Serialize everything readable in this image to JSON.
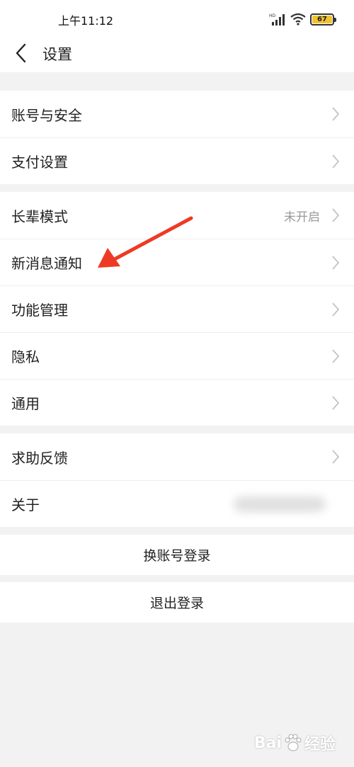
{
  "status_bar": {
    "time": "上午11:12",
    "battery_level": "67",
    "signal_label": "HD"
  },
  "nav": {
    "title": "设置"
  },
  "groups": [
    {
      "items": [
        {
          "label": "账号与安全"
        },
        {
          "label": "支付设置"
        }
      ]
    },
    {
      "items": [
        {
          "label": "长辈模式",
          "value": "未开启"
        },
        {
          "label": "新消息通知"
        },
        {
          "label": "功能管理"
        },
        {
          "label": "隐私"
        },
        {
          "label": "通用"
        }
      ]
    },
    {
      "items": [
        {
          "label": "求助反馈"
        },
        {
          "label": "关于"
        }
      ]
    }
  ],
  "actions": {
    "switch_account": "换账号登录",
    "logout": "退出登录"
  },
  "watermark": {
    "text_1": "Bai",
    "text_2": "经验"
  },
  "colors": {
    "annotation_arrow": "#ee3a24",
    "battery": "#f0c230",
    "background": "#f2f2f2"
  }
}
